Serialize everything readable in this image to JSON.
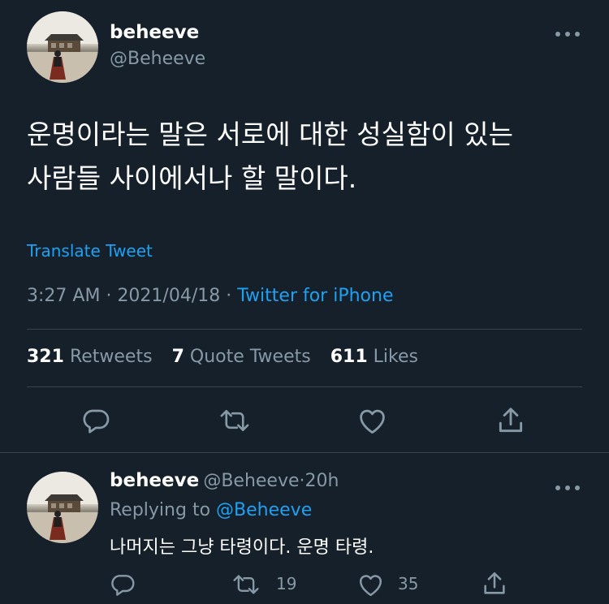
{
  "tweet": {
    "author_name": "beheeve",
    "author_handle": "@Beheeve",
    "more_icon": "...",
    "text_line1": "운명이라는 말은 서로에 대한 성실함이 있는",
    "text_line2": "사람들 사이에서나 할 말이다.",
    "translate_label": "Translate Tweet",
    "time": "3:27 AM",
    "sep": "·",
    "date": "2021/04/18",
    "source": "Twitter for iPhone",
    "stats": {
      "retweets_count": "321",
      "retweets_label": "Retweets",
      "quotes_count": "7",
      "quotes_label": "Quote Tweets",
      "likes_count": "611",
      "likes_label": "Likes"
    }
  },
  "reply": {
    "author_name": "beheeve",
    "author_handle": "@Beheeve",
    "dot": "·",
    "time_ago": "20h",
    "more_icon": "...",
    "replying_prefix": "Replying to",
    "replying_handle": "@Beheeve",
    "text": "나머지는 그냥 타령이다. 운명 타령.",
    "retweet_count": "19",
    "like_count": "35"
  },
  "colors": {
    "background": "#15202b",
    "text": "#ffffff",
    "secondary": "#8899a6",
    "accent": "#1da1f2",
    "divider": "#38444d"
  },
  "icons": [
    "reply-icon",
    "retweet-icon",
    "like-icon",
    "share-icon",
    "more-icon"
  ]
}
